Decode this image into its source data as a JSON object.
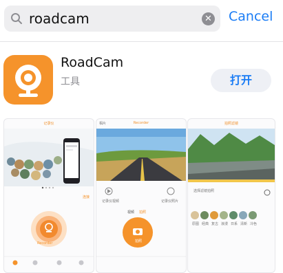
{
  "search": {
    "query": "roadcam",
    "cancel_label": "Cancel"
  },
  "app": {
    "name": "RoadCam",
    "category": "工具",
    "open_label": "打开"
  },
  "screens": [
    {
      "title": "记录仪",
      "button_label": "Recorder",
      "link": "连接"
    },
    {
      "header_left": "相片",
      "title": "Recorder",
      "left_label": "记录仪视频",
      "right_label": "记录仪照片",
      "mode_left": "视频",
      "mode_right": "拍照",
      "capture_label": "拍照"
    },
    {
      "title": "拍照滤镜",
      "left_label": "选择滤镜拍照",
      "filters": [
        "原图",
        "经典",
        "复古",
        "浪漫",
        "日系",
        "清新",
        "冷色"
      ]
    }
  ],
  "colors": {
    "accent": "#f5932b",
    "link": "#1a7cf5"
  }
}
